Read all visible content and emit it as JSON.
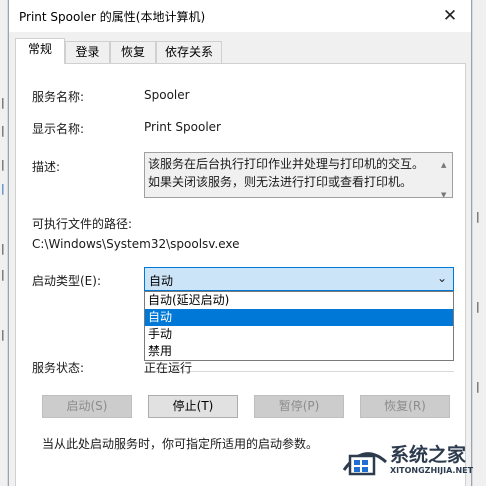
{
  "dialog": {
    "title": "Print Spooler 的属性(本地计算机)",
    "close_glyph": "✕"
  },
  "tabs": [
    {
      "label": "常规",
      "active": true
    },
    {
      "label": "登录",
      "active": false
    },
    {
      "label": "恢复",
      "active": false
    },
    {
      "label": "依存关系",
      "active": false
    }
  ],
  "general": {
    "service_name_label": "服务名称:",
    "service_name_value": "Spooler",
    "display_name_label": "显示名称:",
    "display_name_value": "Print Spooler",
    "description_label": "描述:",
    "description_value": "该服务在后台执行打印作业并处理与打印机的交互。如果关闭该服务，则无法进行打印或查看打印机。",
    "exe_path_label": "可执行文件的路径:",
    "exe_path_value": "C:\\Windows\\System32\\spoolsv.exe",
    "startup_type_label": "启动类型(E):",
    "startup_type_value": "自动",
    "startup_options": [
      "自动(延迟启动)",
      "自动",
      "手动",
      "禁用"
    ],
    "startup_selected_index": 1,
    "status_label": "服务状态:",
    "status_value": "正在运行",
    "buttons": [
      {
        "label": "启动(S)",
        "enabled": false
      },
      {
        "label": "停止(T)",
        "enabled": true
      },
      {
        "label": "暂停(P)",
        "enabled": false
      },
      {
        "label": "恢复(R)",
        "enabled": false
      }
    ],
    "hint_text": "当从此处启动服务时，你可指定所适用的启动参数。"
  },
  "icons": {
    "close": "close-icon",
    "dropdown": "chevron-down-icon",
    "scroll_up": "scroll-up-icon",
    "scroll_down": "scroll-down-icon"
  },
  "watermark": {
    "name": "系统之家",
    "url": "XITONGZHIJIA.NET"
  },
  "colors": {
    "accent": "#0078d7",
    "combo_bg": "#cce4f7",
    "panel_bg": "#ffffff",
    "dialog_bg": "#f0f0f0",
    "watermark": "#2d3b4f"
  }
}
